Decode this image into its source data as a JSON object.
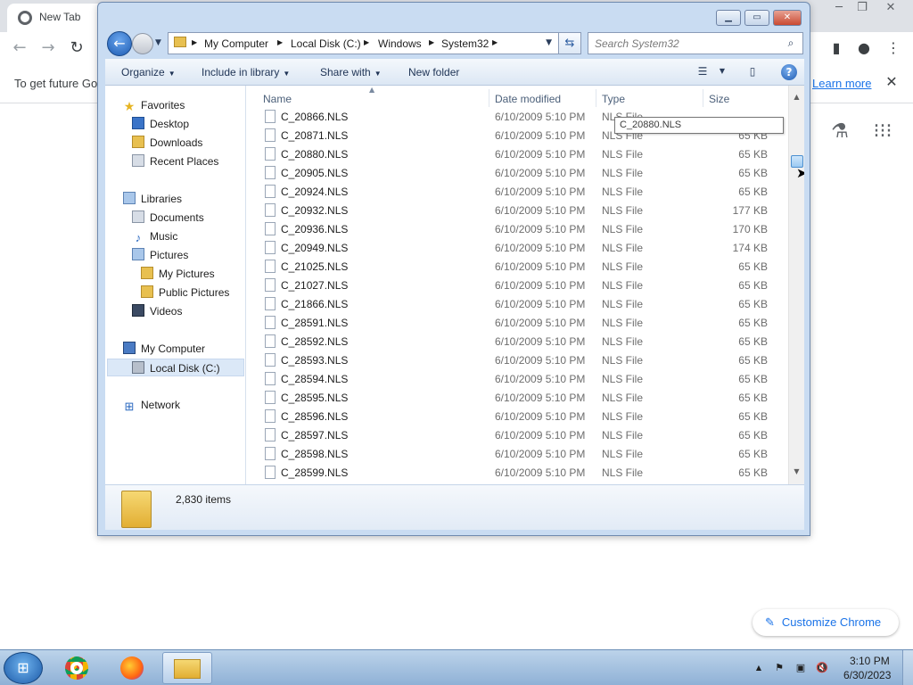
{
  "chrome": {
    "tab_title": "New Tab",
    "infobar_text": "To get future Go",
    "infobar_link": "Learn more",
    "customize_label": "Customize Chrome",
    "minimize": "─",
    "restore": "❐",
    "close": "✕"
  },
  "explorer": {
    "controls": {
      "minimize": "▁",
      "maximize": "▭",
      "close": "✕"
    },
    "breadcrumbs": [
      "My Computer",
      "Local Disk (C:)",
      "Windows",
      "System32"
    ],
    "search_placeholder": "Search System32",
    "commands": {
      "organize": "Organize",
      "include": "Include in library",
      "share": "Share with",
      "new_folder": "New folder"
    },
    "nav": {
      "favorites": "Favorites",
      "desktop": "Desktop",
      "downloads": "Downloads",
      "recent_places": "Recent Places",
      "libraries": "Libraries",
      "documents": "Documents",
      "music": "Music",
      "pictures": "Pictures",
      "my_pictures": "My Pictures",
      "public_pictures": "Public Pictures",
      "videos": "Videos",
      "my_computer": "My Computer",
      "local_disk": "Local Disk (C:)",
      "network": "Network"
    },
    "columns": {
      "name": "Name",
      "date": "Date modified",
      "type": "Type",
      "size": "Size"
    },
    "tooltip": "C_20880.NLS",
    "files": [
      {
        "name": "C_20866.NLS",
        "date": "6/10/2009 5:10 PM",
        "type": "NLS File",
        "size": ""
      },
      {
        "name": "C_20871.NLS",
        "date": "6/10/2009 5:10 PM",
        "type": "NLS File",
        "size": "65 KB"
      },
      {
        "name": "C_20880.NLS",
        "date": "6/10/2009 5:10 PM",
        "type": "NLS File",
        "size": "65 KB"
      },
      {
        "name": "C_20905.NLS",
        "date": "6/10/2009 5:10 PM",
        "type": "NLS File",
        "size": "65 KB"
      },
      {
        "name": "C_20924.NLS",
        "date": "6/10/2009 5:10 PM",
        "type": "NLS File",
        "size": "65 KB"
      },
      {
        "name": "C_20932.NLS",
        "date": "6/10/2009 5:10 PM",
        "type": "NLS File",
        "size": "177 KB"
      },
      {
        "name": "C_20936.NLS",
        "date": "6/10/2009 5:10 PM",
        "type": "NLS File",
        "size": "170 KB"
      },
      {
        "name": "C_20949.NLS",
        "date": "6/10/2009 5:10 PM",
        "type": "NLS File",
        "size": "174 KB"
      },
      {
        "name": "C_21025.NLS",
        "date": "6/10/2009 5:10 PM",
        "type": "NLS File",
        "size": "65 KB"
      },
      {
        "name": "C_21027.NLS",
        "date": "6/10/2009 5:10 PM",
        "type": "NLS File",
        "size": "65 KB"
      },
      {
        "name": "C_21866.NLS",
        "date": "6/10/2009 5:10 PM",
        "type": "NLS File",
        "size": "65 KB"
      },
      {
        "name": "C_28591.NLS",
        "date": "6/10/2009 5:10 PM",
        "type": "NLS File",
        "size": "65 KB"
      },
      {
        "name": "C_28592.NLS",
        "date": "6/10/2009 5:10 PM",
        "type": "NLS File",
        "size": "65 KB"
      },
      {
        "name": "C_28593.NLS",
        "date": "6/10/2009 5:10 PM",
        "type": "NLS File",
        "size": "65 KB"
      },
      {
        "name": "C_28594.NLS",
        "date": "6/10/2009 5:10 PM",
        "type": "NLS File",
        "size": "65 KB"
      },
      {
        "name": "C_28595.NLS",
        "date": "6/10/2009 5:10 PM",
        "type": "NLS File",
        "size": "65 KB"
      },
      {
        "name": "C_28596.NLS",
        "date": "6/10/2009 5:10 PM",
        "type": "NLS File",
        "size": "65 KB"
      },
      {
        "name": "C_28597.NLS",
        "date": "6/10/2009 5:10 PM",
        "type": "NLS File",
        "size": "65 KB"
      },
      {
        "name": "C_28598.NLS",
        "date": "6/10/2009 5:10 PM",
        "type": "NLS File",
        "size": "65 KB"
      },
      {
        "name": "C_28599.NLS",
        "date": "6/10/2009 5:10 PM",
        "type": "NLS File",
        "size": "65 KB"
      }
    ],
    "item_count": "2,830 items"
  },
  "taskbar": {
    "time": "3:10 PM",
    "date": "6/30/2023"
  }
}
